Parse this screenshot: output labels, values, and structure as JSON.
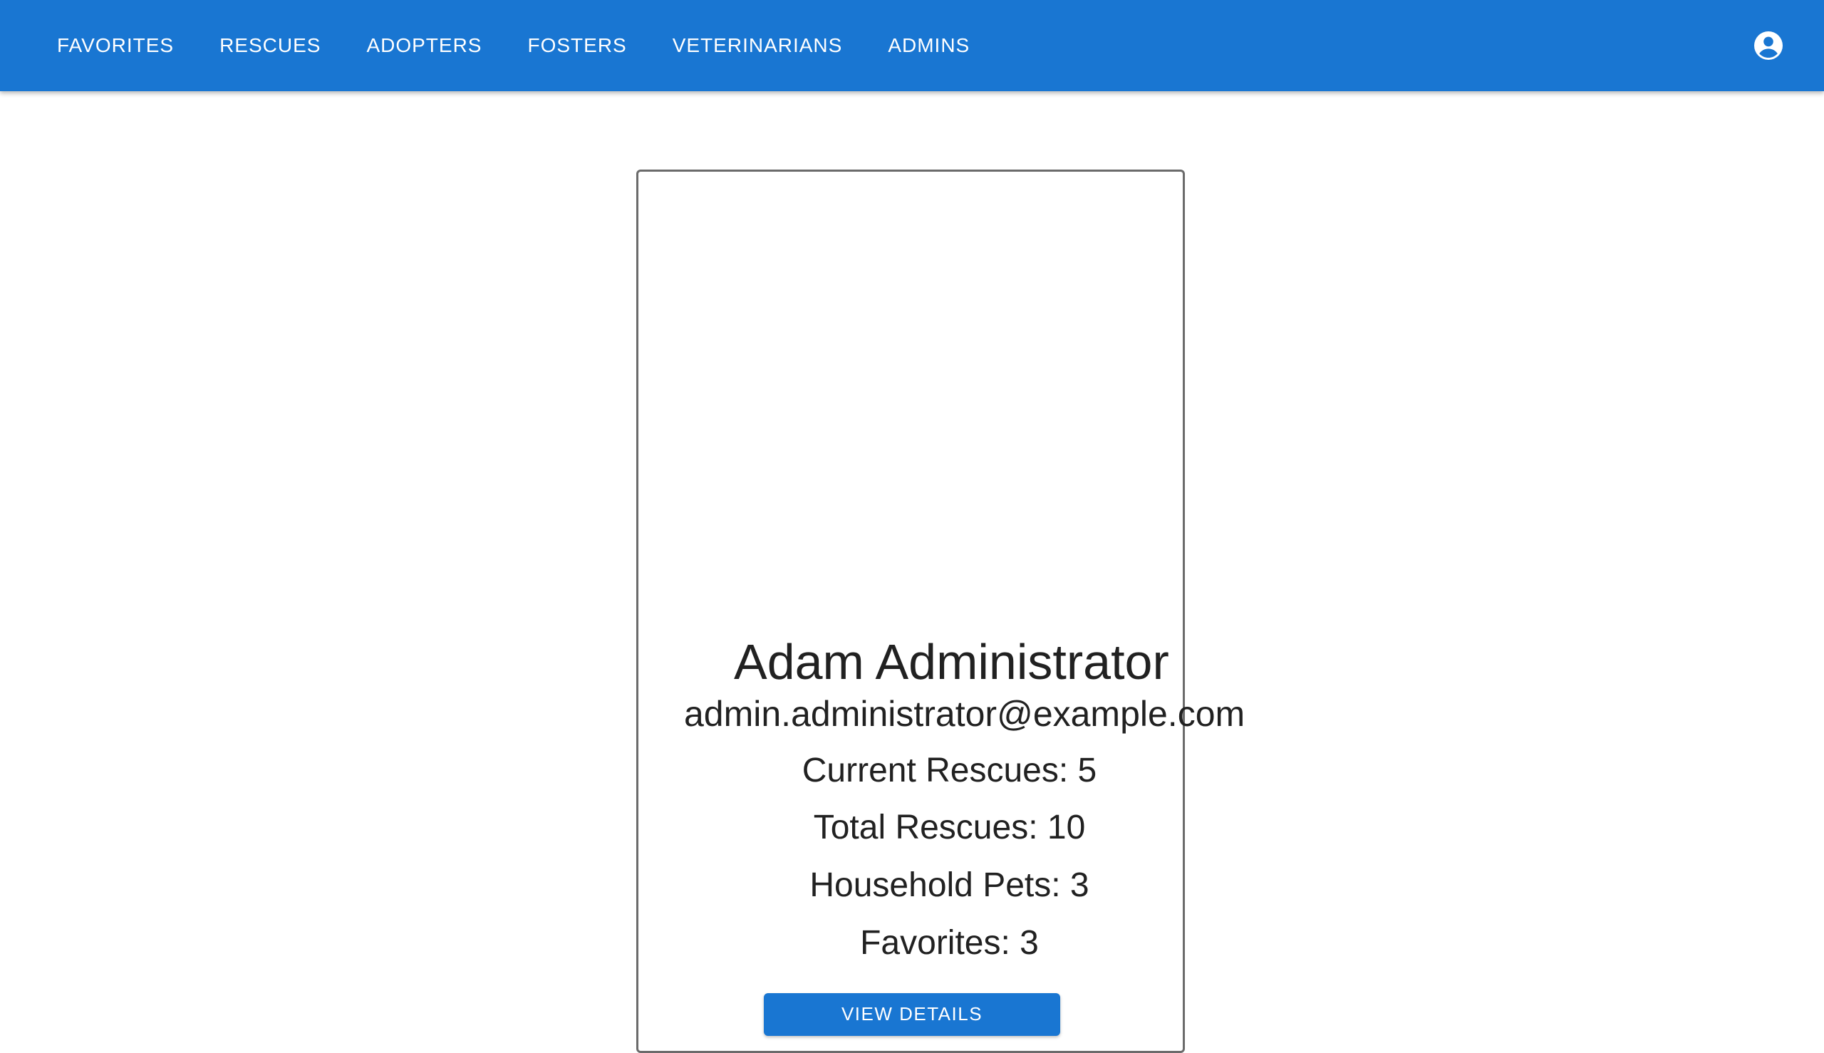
{
  "nav": {
    "items": [
      {
        "label": "FAVORITES"
      },
      {
        "label": "RESCUES"
      },
      {
        "label": "ADOPTERS"
      },
      {
        "label": "FOSTERS"
      },
      {
        "label": "VETERINARIANS"
      },
      {
        "label": "ADMINS"
      }
    ],
    "account_icon": "account-circle-icon"
  },
  "profile": {
    "name": "Adam Administrator",
    "email": "admin.administrator@example.com",
    "current_rescues": "Current Rescues: 5",
    "total_rescues": "Total Rescues: 10",
    "household_pets": "Household Pets: 3",
    "favorites": "Favorites: 3",
    "view_details_label": "VIEW DETAILS"
  },
  "colors": {
    "primary": "#1976d2",
    "text": "#212121",
    "card_border": "#6b6b6b"
  }
}
